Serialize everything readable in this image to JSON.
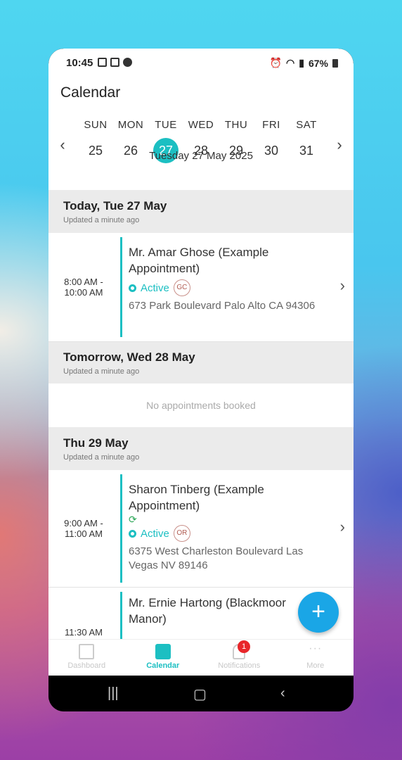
{
  "status": {
    "time": "10:45",
    "battery": "67%"
  },
  "header": {
    "title": "Calendar"
  },
  "week": {
    "days": [
      {
        "name": "SUN",
        "date": "25"
      },
      {
        "name": "MON",
        "date": "26"
      },
      {
        "name": "TUE",
        "date": "27"
      },
      {
        "name": "WED",
        "date": "28"
      },
      {
        "name": "THU",
        "date": "29"
      },
      {
        "name": "FRI",
        "date": "30"
      },
      {
        "name": "SAT",
        "date": "31"
      }
    ],
    "selected_label": "Tuesday 27 May 2025",
    "prev_icon": "chevron-left-icon",
    "next_icon": "chevron-right-icon"
  },
  "sections": [
    {
      "heading": "Today, Tue 27 May",
      "updated": "Updated a minute ago",
      "appointment": {
        "time_start": "8:00 AM -",
        "time_end": "10:00 AM",
        "name": "Mr. Amar Ghose (Example Appointment)",
        "status": "Active",
        "badge": "GC",
        "address": "673 Park Boulevard Palo Alto CA 94306"
      }
    },
    {
      "heading": "Tomorrow, Wed 28 May",
      "updated": "Updated a minute ago",
      "empty": "No appointments booked"
    },
    {
      "heading": "Thu 29 May",
      "updated": "Updated a minute ago",
      "appointment": {
        "time_start": "9:00 AM -",
        "time_end": "11:00 AM",
        "name": "Sharon Tinberg (Example Appointment)",
        "recurring_icon": "refresh-icon",
        "status": "Active",
        "badge": "OR",
        "address": "6375 West Charleston Boulevard Las Vegas NV 89146"
      },
      "appointment2": {
        "time_start": "11:30 AM",
        "name": "Mr. Ernie Hartong (Blackmoor Manor)"
      }
    }
  ],
  "fab": {
    "label": "+"
  },
  "tabs": [
    {
      "label": "Dashboard",
      "icon": "dashboard-icon"
    },
    {
      "label": "Calendar",
      "icon": "calendar-icon",
      "active": true
    },
    {
      "label": "Notifications",
      "icon": "bell-icon",
      "badge": "1"
    },
    {
      "label": "More",
      "icon": "more-icon"
    }
  ],
  "colors": {
    "accent": "#1cbfc2",
    "fab": "#1aa6e6",
    "badge_red": "#e8262a"
  }
}
